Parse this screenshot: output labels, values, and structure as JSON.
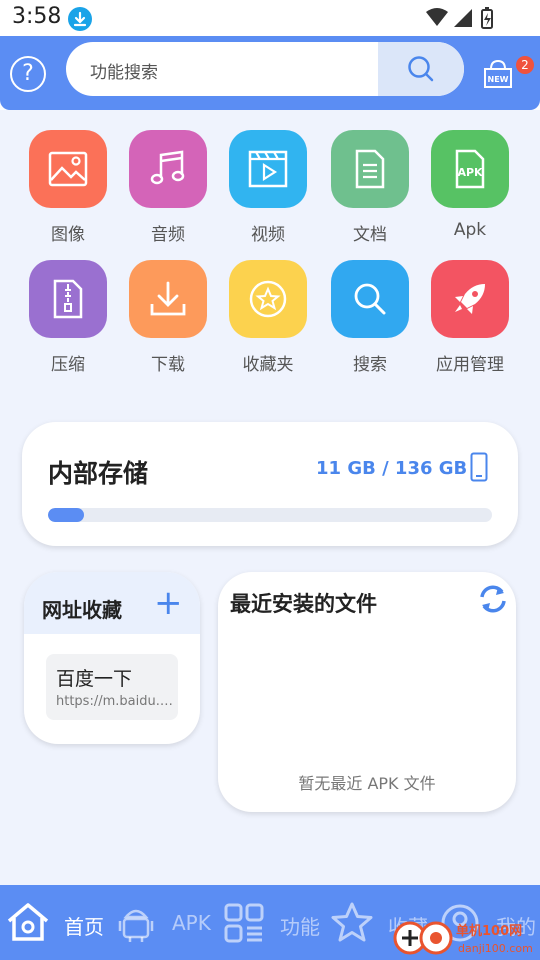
{
  "status_bar": {
    "time": "3:58"
  },
  "header": {
    "search_placeholder": "功能搜索",
    "new_badge_text": "NEW",
    "notification_count": "2",
    "help_glyph": "?"
  },
  "categories": [
    {
      "label": "图像",
      "icon": "image-icon",
      "color": "#fb7158"
    },
    {
      "label": "音频",
      "icon": "music-icon",
      "color": "#d464b8"
    },
    {
      "label": "视频",
      "icon": "video-icon",
      "color": "#31b4f0"
    },
    {
      "label": "文档",
      "icon": "document-icon",
      "color": "#6fc08e"
    },
    {
      "label": "Apk",
      "icon": "apk-icon",
      "color": "#57c264"
    },
    {
      "label": "压缩",
      "icon": "archive-icon",
      "color": "#9a70d0"
    },
    {
      "label": "下载",
      "icon": "download-icon",
      "color": "#fd9a5b"
    },
    {
      "label": "收藏夹",
      "icon": "star-icon",
      "color": "#fcd24e"
    },
    {
      "label": "搜索",
      "icon": "search-icon",
      "color": "#31a8f0"
    },
    {
      "label": "应用管理",
      "icon": "rocket-icon",
      "color": "#f35462"
    }
  ],
  "storage": {
    "title": "内部存储",
    "size_text": "11 GB / 136 GB",
    "used_fraction": 0.081
  },
  "bookmarks": {
    "title": "网址收藏",
    "items": [
      {
        "name": "百度一下",
        "url": "https://m.baidu.com"
      }
    ]
  },
  "recent_installs": {
    "title": "最近安装的文件",
    "empty_text": "暂无最近 APK 文件"
  },
  "bottom_nav": [
    {
      "label": "首页",
      "icon": "home-icon",
      "active": true
    },
    {
      "label": "APK",
      "icon": "android-icon",
      "active": false
    },
    {
      "label": "功能",
      "icon": "grid-icon",
      "active": false
    },
    {
      "label": "收藏",
      "icon": "star-icon",
      "active": false
    },
    {
      "label": "我的",
      "icon": "user-icon",
      "active": false
    }
  ],
  "watermark": {
    "text": "单机100网",
    "sub": "danji100.com"
  },
  "colors": {
    "primary": "#5b8df3",
    "background": "#eff3fd",
    "accent": "#4a86ec"
  }
}
